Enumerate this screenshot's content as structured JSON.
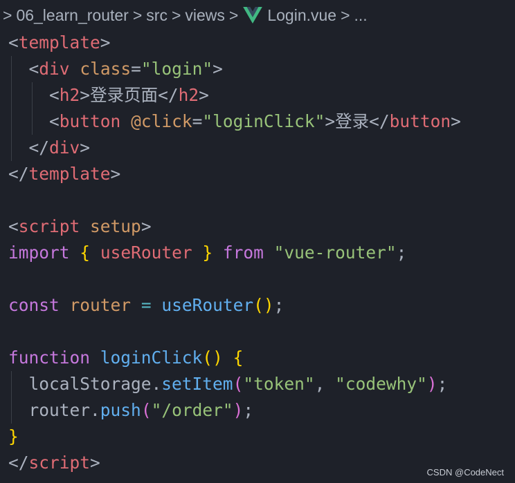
{
  "breadcrumb": {
    "project": "06_learn_router",
    "folder1": "src",
    "folder2": "views",
    "file": "Login.vue",
    "more": "...",
    "separator": ">"
  },
  "code": {
    "l1": [
      "<",
      "template",
      ">"
    ],
    "l2": [
      "<",
      "div",
      "class",
      "=",
      "\"login\"",
      ">"
    ],
    "l3": [
      "<",
      "h2",
      ">",
      "登录页面",
      "</",
      "h2",
      ">"
    ],
    "l4": [
      "<",
      "button",
      "@click",
      "=",
      "\"loginClick\"",
      ">",
      "登录",
      "</",
      "button",
      ">"
    ],
    "l5": [
      "</",
      "div",
      ">"
    ],
    "l6": [
      "</",
      "template",
      ">"
    ],
    "l8": [
      "<",
      "script",
      "setup",
      ">"
    ],
    "l9": [
      "import",
      "{",
      "useRouter",
      "}",
      "from",
      "\"vue-router\"",
      ";"
    ],
    "l11": [
      "const",
      "router",
      "=",
      "useRouter",
      "(",
      ")",
      ";"
    ],
    "l13": [
      "function",
      "loginClick",
      "(",
      ")",
      "{"
    ],
    "l14": [
      "localStorage",
      ".",
      "setItem",
      "(",
      "\"token\"",
      ",",
      "\"codewhy\"",
      ")",
      ";"
    ],
    "l15": [
      "router",
      ".",
      "push",
      "(",
      "\"/order\"",
      ")",
      ";"
    ],
    "l16": [
      "}"
    ],
    "l17": [
      "</",
      "script",
      ">"
    ]
  },
  "watermark": "CSDN @CodeNect",
  "colors": {
    "background": "#1e2129",
    "tag": "#e06c75",
    "attribute": "#d19a66",
    "string": "#98c379",
    "keyword": "#c678dd",
    "function": "#61afef",
    "brace": "#ffd700",
    "paren": "#da70d6",
    "operator": "#56b6c2",
    "vue_logo_green": "#41b883",
    "vue_logo_dark": "#35495e"
  },
  "icons": {
    "breadcrumb_separator": "chevron-right-icon",
    "file_type": "vue-logo-icon"
  }
}
